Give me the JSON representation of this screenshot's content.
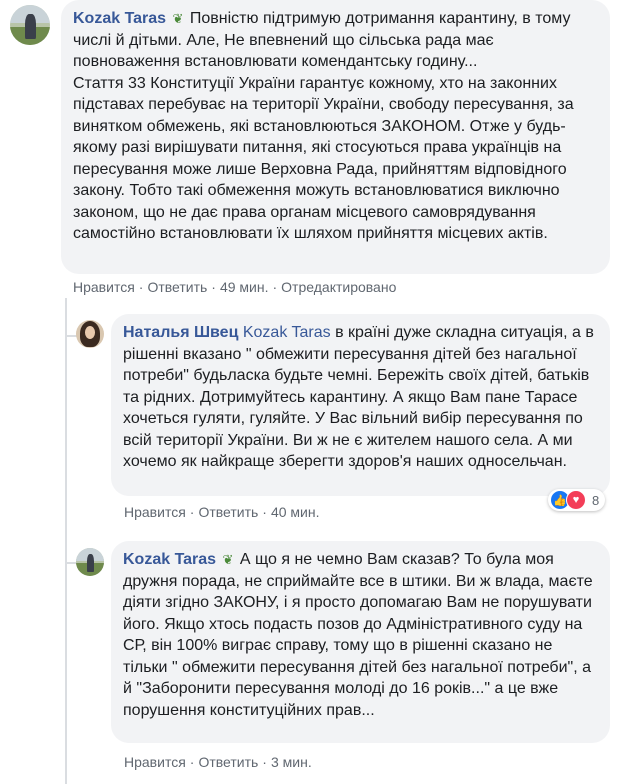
{
  "comments": [
    {
      "author": "Kozak Taras",
      "badge_icon": "sprout-icon",
      "paragraph_1": "Повністю підтримую дотримання карантину, в тому числі й дітьми. Але, Не впевнений що сільська рада має повноваження встановлювати комендантську годину...",
      "paragraph_2": "Стаття 33 Конституції України гарантує кожному, хто на законних підставах перебуває на території України, свободу пересування, за винятком обмежень, які встановлюються ЗАКОНОМ. Отже у будь-якому разі вирішувати питання, які стосуються права українців на пересування може лише Верховна Рада, прийняттям відповідного закону. Тобто такі обмеження можуть встановлюватися виключно законом, що не дає права органам місцевого самоврядування самостійно встановлювати їх шляхом прийняття місцевих актів.",
      "like_label": "Нравится",
      "reply_label": "Ответить",
      "time": "49 мин.",
      "edited_label": "Отредактировано"
    },
    {
      "author": "Наталья Швец",
      "mention": "Kozak Taras",
      "text": "в країні дуже складна ситуація, а в рішенні вказано \" обмежити пересування дітей без нагальної потреби\" будьласка будьте чемні. Бережіть своїх дітей, батьків та рідних. Дотримуйтесь карантину. А якщо Вам пане Тарасе хочеться гуляти, гуляйте. У Вас вільний вибір пересування по всій території України. Ви ж не є жителем нашого села. А ми хочемо як найкраще зберегти здоров'я наших односельчан.",
      "like_label": "Нравится",
      "reply_label": "Ответить",
      "time": "40 мин.",
      "reactions": {
        "count": "8",
        "icons": [
          "like-icon",
          "love-icon"
        ]
      }
    },
    {
      "author": "Kozak Taras",
      "badge_icon": "sprout-icon",
      "text": "А що я не чемно Вам сказав? То була моя дружня порада, не сприймайте все в штики. Ви ж влада, маєте діяти згідно ЗАКОНУ, і я просто допомагаю Вам не порушувати його. Якщо хтось подасть позов до Адміністративного суду на СР, він 100% виграє справу, тому що в рішенні сказано не тільки \" обмежити пересування дітей без нагальної потреби\", а й \"Заборонити пересування молоді до 16 років...\" а це вже порушення конституційних прав...",
      "like_label": "Нравится",
      "reply_label": "Ответить",
      "time": "3 мин."
    }
  ],
  "separator": "·",
  "colors": {
    "author": "#385898",
    "bubble": "#f2f3f5",
    "meta": "#606770",
    "like": "#1877f2",
    "love": "#f33e58"
  }
}
